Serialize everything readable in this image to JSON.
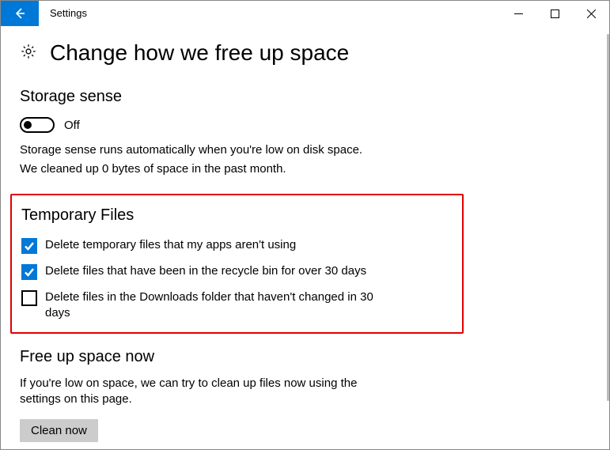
{
  "titlebar": {
    "title": "Settings"
  },
  "page": {
    "title": "Change how we free up space"
  },
  "storage_sense": {
    "heading": "Storage sense",
    "toggle_state": "Off",
    "desc_line1": "Storage sense runs automatically when you're low on disk space.",
    "desc_line2": "We cleaned up 0 bytes of space in the past month."
  },
  "temp_files": {
    "heading": "Temporary Files",
    "items": [
      {
        "checked": true,
        "label": "Delete temporary files that my apps aren't using"
      },
      {
        "checked": true,
        "label": "Delete files that have been in the recycle bin for over 30 days"
      },
      {
        "checked": false,
        "label": "Delete files in the Downloads folder that haven't changed in 30 days"
      }
    ]
  },
  "free_up": {
    "heading": "Free up space now",
    "desc": "If you're low on space, we can try to clean up files now using the settings on this page.",
    "button": "Clean now"
  }
}
